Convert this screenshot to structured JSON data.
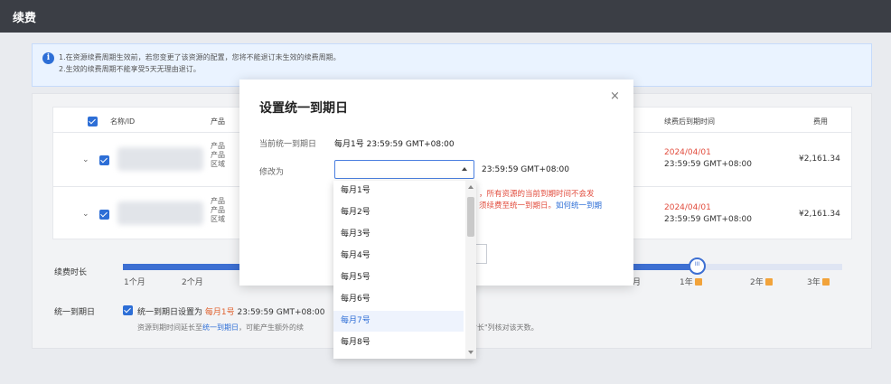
{
  "header": {
    "title": "续费"
  },
  "notice": {
    "line1": "1.在资源续费周期生效前，若您变更了该资源的配置，您将不能退订未生效的续费周期。",
    "line2": "2.生效的续费周期不能享受5天无理由退订。"
  },
  "table": {
    "columns": {
      "name": "名称/ID",
      "product": "产品",
      "expiry": "续费后到期时间",
      "fee": "费用"
    },
    "rows": [
      {
        "product_lines": [
          "产品",
          "产品",
          "区域"
        ],
        "expiry_date": "2024/04/01",
        "expiry_time": "23:59:59 GMT+08:00",
        "fee": "¥2,161.34"
      },
      {
        "product_lines": [
          "产品",
          "产品",
          "区域"
        ],
        "expiry_date": "2024/04/01",
        "expiry_time": "23:59:59 GMT+08:00",
        "fee": "¥2,161.34"
      }
    ]
  },
  "duration": {
    "label": "续费时长",
    "ticks": [
      "1个月",
      "2个月",
      "月",
      "1年",
      "2年",
      "3年"
    ],
    "selected": "1年"
  },
  "unified": {
    "label": "统一到期日",
    "text_prefix": "统一到期日设置为 ",
    "text_value": "每月1号",
    "text_suffix": " 23:59:59 GMT+08:00",
    "sub_prefix": "资源到期时间延长至",
    "sub_link": "统一到期日",
    "sub_suffix": "，可能产生额外的续",
    "sub_tail": "时长\"列核对该天数。"
  },
  "modal": {
    "title": "设置统一到期日",
    "close": "×",
    "current_label": "当前统一到期日",
    "current_value": "每月1号  23:59:59 GMT+08:00",
    "modify_label": "修改为",
    "select_value": "",
    "time_suffix": "23:59:59 GMT+08:00",
    "warn_line1": "，所有资源的当前到期时间不会发",
    "warn_line2_prefix": "须续费至统一到期日。",
    "warn_line2_link": "如何统一到期"
  },
  "dropdown": {
    "options": [
      "每月1号",
      "每月2号",
      "每月3号",
      "每月4号",
      "每月5号",
      "每月6号",
      "每月7号",
      "每月8号"
    ],
    "highlighted": "每月7号"
  },
  "colors": {
    "primary": "#2d6ed6",
    "topbar": "#3b3e45",
    "warning": "#e24d3e",
    "accent": "#e0612e"
  }
}
